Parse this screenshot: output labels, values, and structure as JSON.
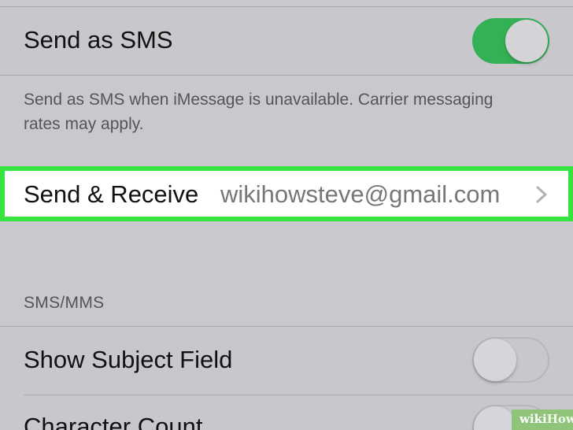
{
  "rows": {
    "send_as_sms": {
      "label": "Send as SMS",
      "toggle": "on"
    },
    "send_receive": {
      "label": "Send & Receive",
      "value": "wikihowsteve@gmail.com"
    },
    "show_subject_field": {
      "label": "Show Subject Field",
      "toggle": "off"
    },
    "character_count": {
      "label": "Character Count",
      "toggle": "off"
    }
  },
  "footer": {
    "sms_note": "Send as SMS when iMessage is unavailable. Carrier messaging rates may apply."
  },
  "sections": {
    "sms_mms_header": "SMS/MMS"
  },
  "watermark": {
    "wiki": "wiki",
    "how": "How"
  },
  "colors": {
    "toggle_on": "#35b155",
    "highlight_border": "#37e33e",
    "background": "#c8c7cc"
  },
  "icons": [
    "chevron-right-icon"
  ]
}
